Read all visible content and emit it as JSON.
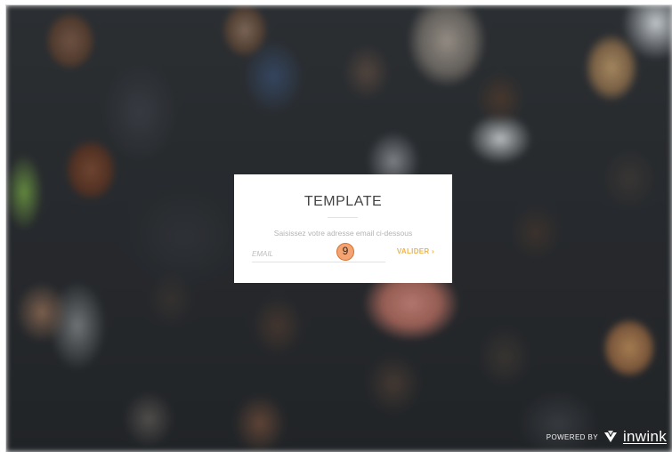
{
  "login_card": {
    "title": "TEMPLATE",
    "subtitle": "Saisissez votre adresse email ci-dessous",
    "email_placeholder": "EMAIL",
    "email_value": "",
    "submit_label": "VALIDER",
    "submit_arrow": "›",
    "step_badge": "9"
  },
  "footer": {
    "powered_by": "POWERED BY",
    "brand": "inwink",
    "brand_icon": "inwink-logo-icon"
  },
  "colors": {
    "accent": "#f0b34a",
    "badge_fill": "#f4a373",
    "badge_border": "#d4722f",
    "card_bg": "#ffffff",
    "title_text": "#444444",
    "subtitle_text": "#b3b3b3"
  }
}
